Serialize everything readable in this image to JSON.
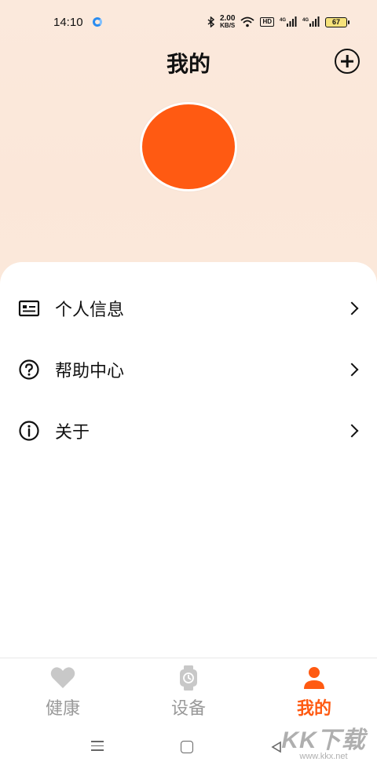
{
  "status_bar": {
    "time": "14:10",
    "net_speed_value": "2.00",
    "net_speed_unit": "KB/S",
    "hd_label": "HD",
    "signal1_label": "4G",
    "signal2_label": "4G",
    "battery_level": "67"
  },
  "header": {
    "title": "我的"
  },
  "menu": {
    "items": [
      {
        "label": "个人信息",
        "icon": "id-card-icon"
      },
      {
        "label": "帮助中心",
        "icon": "help-circle-icon"
      },
      {
        "label": "关于",
        "icon": "info-circle-icon"
      }
    ]
  },
  "bottom_nav": {
    "tabs": [
      {
        "label": "健康",
        "icon": "heart-icon",
        "active": false
      },
      {
        "label": "设备",
        "icon": "watch-icon",
        "active": false
      },
      {
        "label": "我的",
        "icon": "person-icon",
        "active": true
      }
    ]
  },
  "watermark": {
    "main": "KK下载",
    "sub": "www.kkx.net"
  },
  "colors": {
    "accent": "#ff5a12",
    "inactive_tab": "#9a9a9a",
    "header_bg": "#fbe9dc"
  }
}
